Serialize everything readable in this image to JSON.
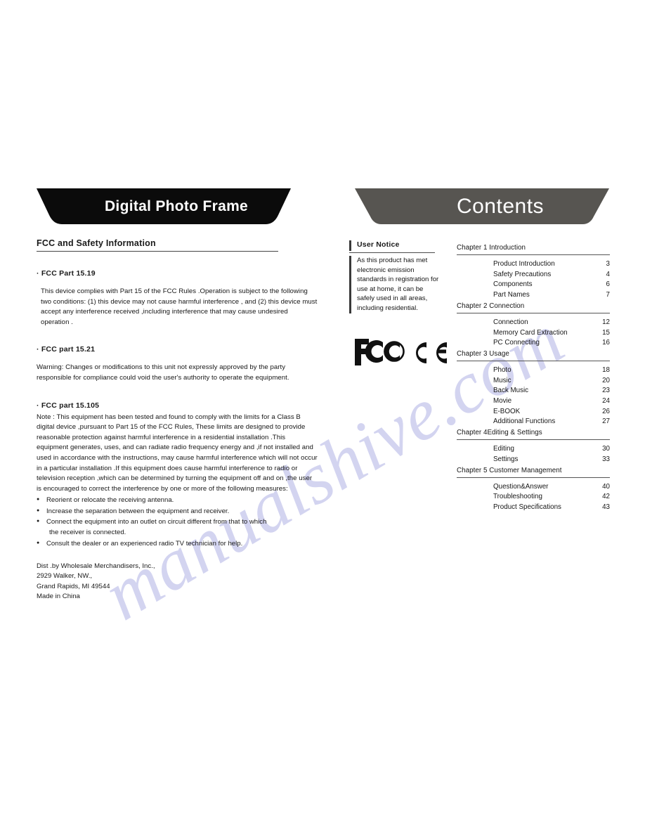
{
  "page": {
    "watermark": "manualshive.com"
  },
  "left": {
    "banner_title": "Digital Photo Frame",
    "section_title": "FCC and Safety Information",
    "part_15_19": {
      "heading": "· FCC Part 15.19",
      "body": "This device complies with Part 15 of the FCC Rules .Operation is subject to the following two conditions: (1) this device may not cause harmful interference , and (2) this device must accept any interference received ,including interference that may cause undesired operation ."
    },
    "part_15_21": {
      "heading": "· FCC part 15.21",
      "body": "Warning: Changes or modifications to this unit not expressly approved by the party responsible for compliance could void the user's authority to operate the equipment."
    },
    "part_15_105": {
      "heading": "· FCC part 15.105",
      "body": "Note : This equipment has been tested and found to comply with the limits for a Class B digital device ,pursuant to Part 15 of the FCC Rules, These limits are designed to provide reasonable protection against harmful interference in a residential installation .This equipment generates, uses, and can radiate radio frequency energy and ,if not installed and used in accordance with the instructions, may cause harmful interference which will not occur in a particular installation .If this equipment does cause harmful interference to radio or television reception ,which can be determined by turning the equipment off and on ,the user is encouraged to correct the interference by one or more of  the following measures:",
      "measures": [
        {
          "text": "Reorient or relocate the receiving antenna.",
          "cont": ""
        },
        {
          "text": "Increase the separation between the equipment and receiver.",
          "cont": ""
        },
        {
          "text": "Connect the equipment into an outlet on circuit different from that to which",
          "cont": "the receiver is connected."
        },
        {
          "text": "Consult the dealer or an experienced radio TV technician for help.",
          "cont": ""
        }
      ]
    },
    "address": [
      "Dist .by Wholesale Merchandisers, Inc.,",
      "2929 Walker, NW.,",
      "Grand Rapids, MI 49544",
      "Made in China"
    ]
  },
  "right": {
    "banner_title": "Contents",
    "notice": {
      "title": "User Notice",
      "body": "As this product has met electronic emission standards in registration for use at home, it can be safely used in all areas, including residential."
    },
    "cert_marks": [
      "fcc-mark",
      "ce-mark"
    ],
    "toc": [
      {
        "chapter": "Chapter 1 Introduction",
        "entries": [
          {
            "label": "Product Introduction",
            "page": "3"
          },
          {
            "label": "Safety Precautions",
            "page": "4"
          },
          {
            "label": "Components",
            "page": "6"
          },
          {
            "label": "Part Names",
            "page": "7"
          }
        ]
      },
      {
        "chapter": "Chapter 2 Connection",
        "entries": [
          {
            "label": "Connection",
            "page": "12"
          },
          {
            "label": "Memory Card Extraction",
            "page": "15"
          },
          {
            "label": "PC Connecting",
            "page": "16"
          }
        ]
      },
      {
        "chapter": "Chapter 3 Usage",
        "entries": [
          {
            "label": "Photo",
            "page": "18"
          },
          {
            "label": "Music",
            "page": "20"
          },
          {
            "label": "Back Music",
            "page": "23"
          },
          {
            "label": "Movie",
            "page": "24"
          },
          {
            "label": "E-BOOK",
            "page": "26"
          },
          {
            "label": "Additional Functions",
            "page": "27"
          }
        ]
      },
      {
        "chapter": "Chapter 4Editing & Settings",
        "entries": [
          {
            "label": "Editing",
            "page": "30"
          },
          {
            "label": "Settings",
            "page": "33"
          }
        ]
      },
      {
        "chapter": "Chapter 5 Customer Management",
        "entries": [
          {
            "label": "Question&Answer",
            "page": "40"
          },
          {
            "label": "Troubleshooting",
            "page": "42"
          },
          {
            "label": "Product Specifications",
            "page": "43"
          }
        ]
      }
    ]
  },
  "colors": {
    "banner_left": "#0b0b0b",
    "banner_right": "#575551",
    "watermark": "#b9bbe8",
    "text": "#161616"
  }
}
